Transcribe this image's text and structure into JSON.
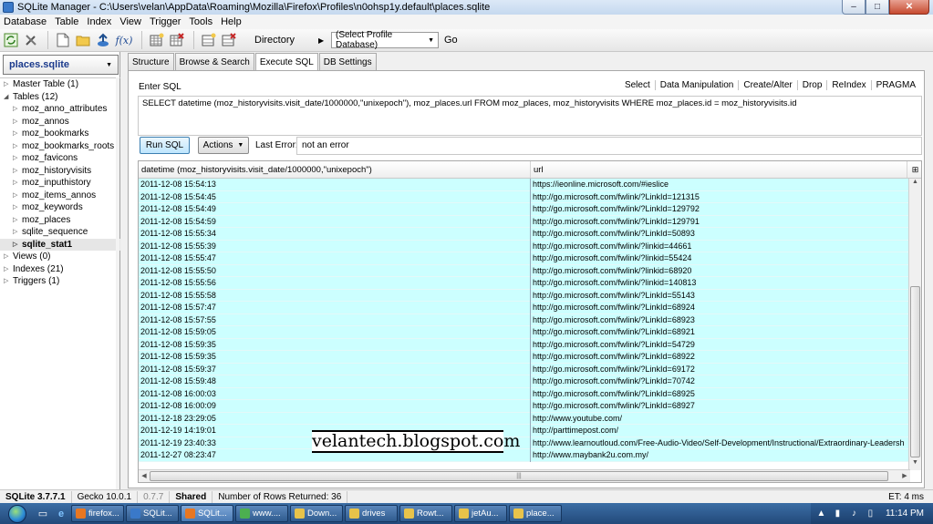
{
  "window": {
    "title": "SQLite Manager - C:\\Users\\velan\\AppData\\Roaming\\Mozilla\\Firefox\\Profiles\\n0ohsp1y.default\\places.sqlite",
    "min": "–",
    "max": "□",
    "close": "✕"
  },
  "menu": [
    "Database",
    "Table",
    "Index",
    "View",
    "Trigger",
    "Tools",
    "Help"
  ],
  "toolbar": {
    "directory_label": "Directory",
    "arrow": "▶",
    "profile_select": "(Select Profile Database)",
    "go": "Go",
    "fx": "f(x)"
  },
  "sidebar": {
    "database": "places.sqlite",
    "tree": [
      {
        "label": "Master Table (1)",
        "level": 0,
        "bold": false,
        "selected": false
      },
      {
        "label": "Tables (12)",
        "level": 0,
        "bold": false,
        "selected": false,
        "expanded": true
      },
      {
        "label": "moz_anno_attributes",
        "level": 1,
        "bold": false,
        "selected": false
      },
      {
        "label": "moz_annos",
        "level": 1,
        "bold": false,
        "selected": false
      },
      {
        "label": "moz_bookmarks",
        "level": 1,
        "bold": false,
        "selected": false
      },
      {
        "label": "moz_bookmarks_roots",
        "level": 1,
        "bold": false,
        "selected": false
      },
      {
        "label": "moz_favicons",
        "level": 1,
        "bold": false,
        "selected": false
      },
      {
        "label": "moz_historyvisits",
        "level": 1,
        "bold": false,
        "selected": false
      },
      {
        "label": "moz_inputhistory",
        "level": 1,
        "bold": false,
        "selected": false
      },
      {
        "label": "moz_items_annos",
        "level": 1,
        "bold": false,
        "selected": false
      },
      {
        "label": "moz_keywords",
        "level": 1,
        "bold": false,
        "selected": false
      },
      {
        "label": "moz_places",
        "level": 1,
        "bold": false,
        "selected": false
      },
      {
        "label": "sqlite_sequence",
        "level": 1,
        "bold": false,
        "selected": false
      },
      {
        "label": "sqlite_stat1",
        "level": 1,
        "bold": true,
        "selected": true
      },
      {
        "label": "Views (0)",
        "level": 0,
        "bold": false,
        "selected": false
      },
      {
        "label": "Indexes (21)",
        "level": 0,
        "bold": false,
        "selected": false
      },
      {
        "label": "Triggers (1)",
        "level": 0,
        "bold": false,
        "selected": false
      }
    ]
  },
  "tabs": [
    {
      "label": "Structure",
      "active": false
    },
    {
      "label": "Browse & Search",
      "active": false
    },
    {
      "label": "Execute SQL",
      "active": true
    },
    {
      "label": "DB Settings",
      "active": false
    }
  ],
  "execute": {
    "enter_sql": "Enter SQL",
    "sql_toolbar": [
      "Select",
      "Data Manipulation",
      "Create/Alter",
      "Drop",
      "ReIndex",
      "PRAGMA"
    ],
    "sql_text": "SELECT datetime (moz_historyvisits.visit_date/1000000,\"unixepoch\"), moz_places.url FROM moz_places, moz_historyvisits WHERE moz_places.id = moz_historyvisits.id",
    "run_sql": "Run SQL",
    "actions": "Actions",
    "last_error_label": "Last Error:",
    "last_error_value": "not an error"
  },
  "results": {
    "columns": [
      "datetime (moz_historyvisits.visit_date/1000000,\"unixepoch\")",
      "url"
    ],
    "rows": [
      [
        "2011-12-08 15:54:13",
        "https://ieonline.microsoft.com/#ieslice"
      ],
      [
        "2011-12-08 15:54:45",
        "http://go.microsoft.com/fwlink/?LinkId=121315"
      ],
      [
        "2011-12-08 15:54:49",
        "http://go.microsoft.com/fwlink/?LinkId=129792"
      ],
      [
        "2011-12-08 15:54:59",
        "http://go.microsoft.com/fwlink/?LinkId=129791"
      ],
      [
        "2011-12-08 15:55:34",
        "http://go.microsoft.com/fwlink/?LinkId=50893"
      ],
      [
        "2011-12-08 15:55:39",
        "http://go.microsoft.com/fwlink/?linkid=44661"
      ],
      [
        "2011-12-08 15:55:47",
        "http://go.microsoft.com/fwlink/?linkid=55424"
      ],
      [
        "2011-12-08 15:55:50",
        "http://go.microsoft.com/fwlink/?linkid=68920"
      ],
      [
        "2011-12-08 15:55:56",
        "http://go.microsoft.com/fwlink/?linkid=140813"
      ],
      [
        "2011-12-08 15:55:58",
        "http://go.microsoft.com/fwlink/?LinkId=55143"
      ],
      [
        "2011-12-08 15:57:47",
        "http://go.microsoft.com/fwlink/?LinkId=68924"
      ],
      [
        "2011-12-08 15:57:55",
        "http://go.microsoft.com/fwlink/?LinkId=68923"
      ],
      [
        "2011-12-08 15:59:05",
        "http://go.microsoft.com/fwlink/?LinkId=68921"
      ],
      [
        "2011-12-08 15:59:35",
        "http://go.microsoft.com/fwlink/?LinkId=54729"
      ],
      [
        "2011-12-08 15:59:35",
        "http://go.microsoft.com/fwlink/?LinkId=68922"
      ],
      [
        "2011-12-08 15:59:37",
        "http://go.microsoft.com/fwlink/?LinkId=69172"
      ],
      [
        "2011-12-08 15:59:48",
        "http://go.microsoft.com/fwlink/?LinkId=70742"
      ],
      [
        "2011-12-08 16:00:03",
        "http://go.microsoft.com/fwlink/?LinkId=68925"
      ],
      [
        "2011-12-08 16:00:09",
        "http://go.microsoft.com/fwlink/?LinkId=68927"
      ],
      [
        "2011-12-18 23:29:05",
        "http://www.youtube.com/"
      ],
      [
        "2011-12-19 14:19:01",
        "http://parttimepost.com/"
      ],
      [
        "2011-12-19 23:40:33",
        "http://www.learnoutloud.com/Free-Audio-Video/Self-Development/Instructional/Extraordinary-Leadersh"
      ],
      [
        "2011-12-27 08:23:47",
        "http://www.maybank2u.com.my/"
      ]
    ]
  },
  "watermark": "velantech.blogspot.com",
  "status": {
    "version": "SQLite 3.7.7.1",
    "gecko": "Gecko 10.0.1",
    "ext_version": "0.7.7",
    "shared": "Shared",
    "rows_returned": "Number of Rows Returned: 36",
    "elapsed": "ET: 4 ms"
  },
  "taskbar": {
    "tasks": [
      {
        "label": "firefox...",
        "color": "#e87722",
        "active": false
      },
      {
        "label": "SQLit...",
        "color": "#3a79c9",
        "active": false
      },
      {
        "label": "SQLit...",
        "color": "#e87722",
        "active": true
      },
      {
        "label": "www....",
        "color": "#4caf50",
        "active": false
      },
      {
        "label": "Down...",
        "color": "#e8c34a",
        "active": false
      },
      {
        "label": "drives",
        "color": "#e8c34a",
        "active": false
      },
      {
        "label": "Rowt...",
        "color": "#e8c34a",
        "active": false
      },
      {
        "label": "jetAu...",
        "color": "#e8c34a",
        "active": false
      },
      {
        "label": "place...",
        "color": "#e8c34a",
        "active": false
      }
    ],
    "clock": "11:14 PM"
  }
}
